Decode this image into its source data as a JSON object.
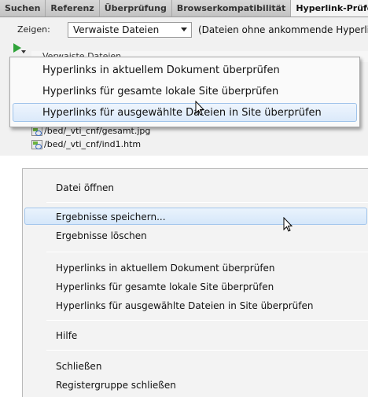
{
  "panel": {
    "tabs": [
      "Suchen",
      "Referenz",
      "Überprüfung",
      "Browserkompatibilität",
      "Hyperlink-Prüfer"
    ],
    "show_label": "Zeigen:",
    "filter_value": "Verwaiste Dateien",
    "filter_hint": "(Dateien ohne ankommende Hyperlinks",
    "results_header": "Verwaiste Dateien",
    "files": [
      "/bed/_vti_cnf/gesamt.jpg",
      "/bed/_vti_cnf/ind1.htm"
    ],
    "run_icon": "play-arrow-icon"
  },
  "dropdown": {
    "items": [
      "Hyperlinks in aktuellem Dokument überprüfen",
      "Hyperlinks für gesamte lokale Site überprüfen",
      "Hyperlinks für ausgewählte Dateien in Site überprüfen"
    ],
    "highlighted_index": 2
  },
  "context_menu": {
    "open_file": "Datei öffnen",
    "save_results": "Ergebnisse speichern...",
    "clear_results": "Ergebnisse löschen",
    "check_current": "Hyperlinks in aktuellem Dokument überprüfen",
    "check_site": "Hyperlinks für gesamte lokale Site überprüfen",
    "check_selected": "Hyperlinks für ausgewählte Dateien in Site überprüfen",
    "help": "Hilfe",
    "close": "Schließen",
    "close_group": "Registergruppe schließen",
    "highlighted": "save_results"
  },
  "colors": {
    "accent_highlight": "#dbe9fa",
    "run_icon": "#2fa33a",
    "tab_bar": "#c8c8c8"
  }
}
